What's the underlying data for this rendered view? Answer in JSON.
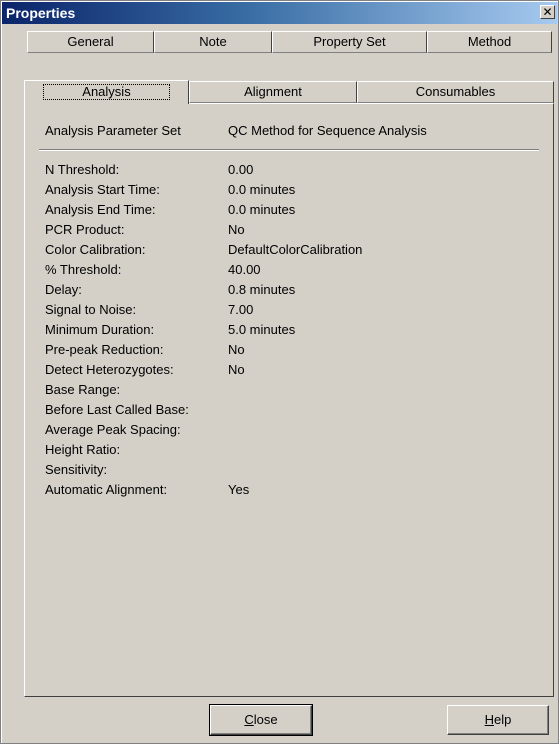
{
  "window": {
    "title": "Properties",
    "close_glyph": "✕"
  },
  "tabs_back": [
    "General",
    "Note",
    "Property Set",
    "Method"
  ],
  "tabs_front": [
    "Analysis",
    "Alignment",
    "Consumables"
  ],
  "header": {
    "label": "Analysis Parameter Set",
    "value": "QC Method for Sequence Analysis"
  },
  "params": [
    {
      "label": "N Threshold:",
      "value": "0.00"
    },
    {
      "label": "Analysis Start Time:",
      "value": "0.0 minutes"
    },
    {
      "label": "Analysis End Time:",
      "value": "0.0 minutes"
    },
    {
      "label": "PCR Product:",
      "value": "No"
    },
    {
      "label": "Color Calibration:",
      "value": "DefaultColorCalibration"
    },
    {
      "label": "% Threshold:",
      "value": "40.00"
    },
    {
      "label": "Delay:",
      "value": "0.8 minutes"
    },
    {
      "label": "Signal to Noise:",
      "value": "7.00"
    },
    {
      "label": "Minimum Duration:",
      "value": "5.0 minutes"
    },
    {
      "label": "Pre-peak Reduction:",
      "value": "No"
    },
    {
      "label": "Detect Heterozygotes:",
      "value": "No"
    },
    {
      "label": "Base Range:",
      "value": ""
    },
    {
      "label": "Before Last Called Base:",
      "value": ""
    },
    {
      "label": "Average Peak Spacing:",
      "value": ""
    },
    {
      "label": "Height Ratio:",
      "value": ""
    },
    {
      "label": "Sensitivity:",
      "value": ""
    },
    {
      "label": "Automatic Alignment:",
      "value": "Yes"
    }
  ],
  "buttons": {
    "close_key": "C",
    "close_rest": "lose",
    "help_key": "H",
    "help_rest": "elp"
  }
}
